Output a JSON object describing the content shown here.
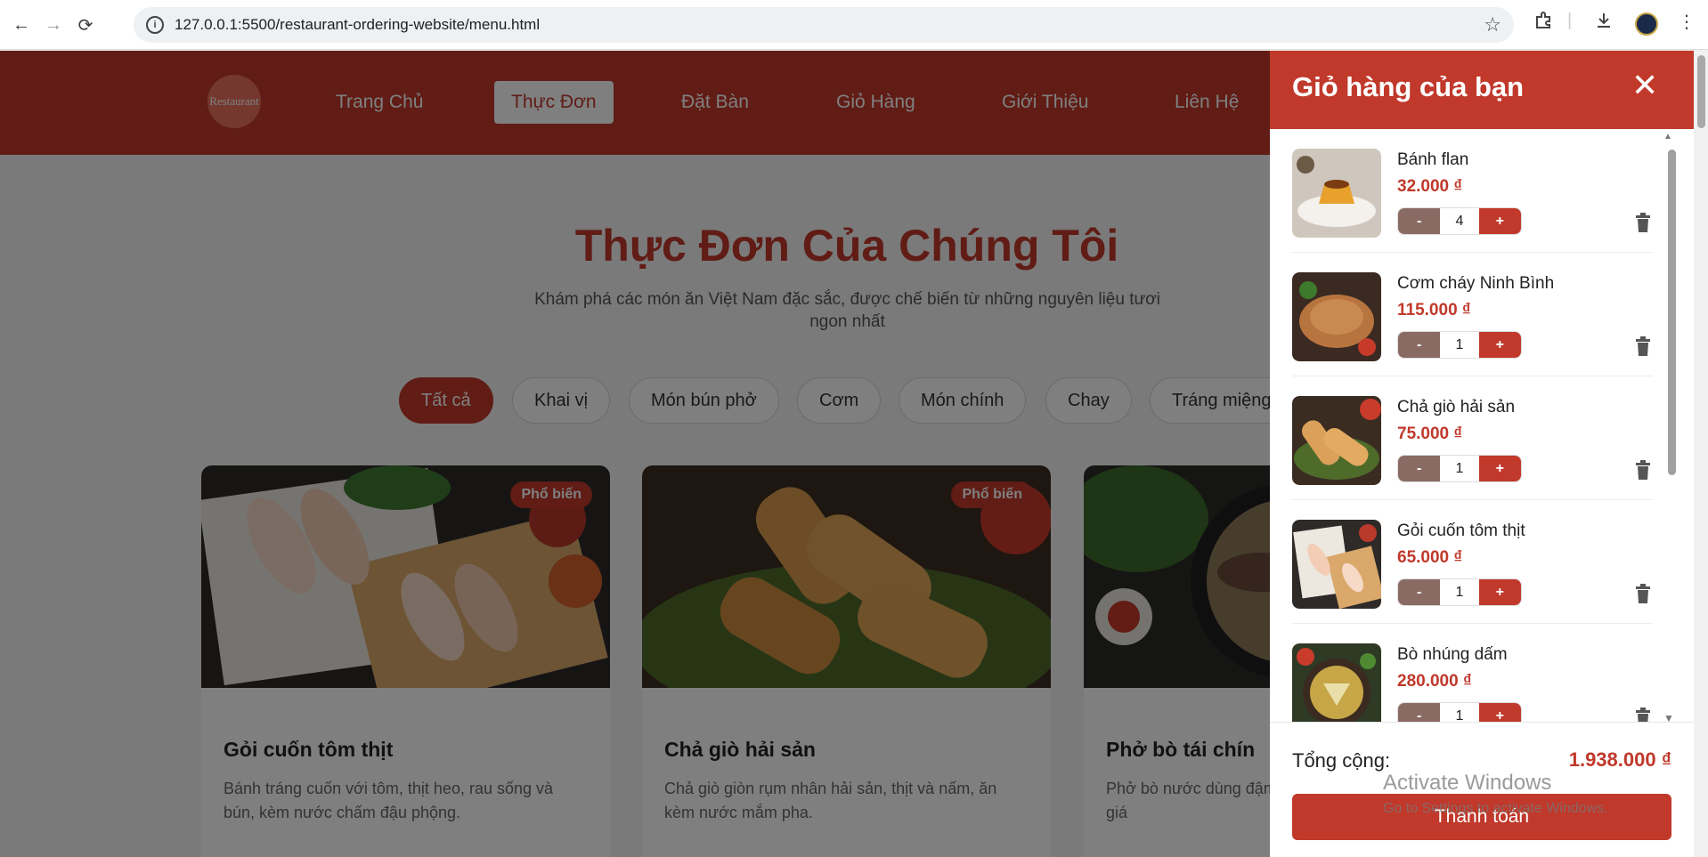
{
  "browser": {
    "url": "127.0.0.1:5500/restaurant-ordering-website/menu.html"
  },
  "site": {
    "logo_text": "Restaurant",
    "nav": [
      {
        "label": "Trang Chủ"
      },
      {
        "label": "Thực Đơn",
        "active": true
      },
      {
        "label": "Đặt Bàn"
      },
      {
        "label": "Giỏ Hàng"
      },
      {
        "label": "Giới Thiệu"
      },
      {
        "label": "Liên Hệ"
      }
    ]
  },
  "hero": {
    "title": "Thực Đơn Của Chúng Tôi",
    "subtitle": "Khám phá các món ăn Việt Nam đặc sắc, được chế biến từ những nguyên liệu tươi ngon nhất"
  },
  "filters": [
    {
      "label": "Tất cả",
      "active": true
    },
    {
      "label": "Khai vị"
    },
    {
      "label": "Món bún phở"
    },
    {
      "label": "Cơm"
    },
    {
      "label": "Món chính"
    },
    {
      "label": "Chay"
    },
    {
      "label": "Tráng miệng"
    }
  ],
  "menu_cards": [
    {
      "title": "Gỏi cuốn tôm thịt",
      "badge": "Phổ biến",
      "desc": "Bánh tráng cuốn với tôm, thịt heo, rau sống và bún, kèm nước chấm đậu phộng."
    },
    {
      "title": "Chả giò hải sản",
      "badge": "Phổ biến",
      "desc": "Chả giò giòn rụm nhân hải sản, thịt và nấm, ăn kèm nước mắm pha."
    },
    {
      "title": "Phở bò tái chín",
      "badge": "",
      "desc": "Phở bò nước dùng đậm đà, ăn kèm rau thơm và giá"
    }
  ],
  "cart": {
    "title": "Giỏ hàng của bạn",
    "close_icon": "close-icon",
    "items": [
      {
        "name": "Bánh flan",
        "price": "32.000 ₫",
        "qty": "4"
      },
      {
        "name": "Cơm cháy Ninh Bình",
        "price": "115.000 ₫",
        "qty": "1"
      },
      {
        "name": "Chả giò hải sản",
        "price": "75.000 ₫",
        "qty": "1"
      },
      {
        "name": "Gỏi cuốn tôm thịt",
        "price": "65.000 ₫",
        "qty": "1"
      },
      {
        "name": "Bò nhúng dấm",
        "price": "280.000 ₫",
        "qty": "1"
      }
    ],
    "minus_label": "-",
    "plus_label": "+",
    "total_label": "Tổng cộng:",
    "total_value": "1.938.000 ₫",
    "checkout_label": "Thanh toán"
  },
  "watermark": {
    "line1": "Activate Windows",
    "line2": "Go to Settings to activate Windows."
  },
  "colors": {
    "brand": "#c0392b",
    "qty_minus": "#8a6b63"
  }
}
